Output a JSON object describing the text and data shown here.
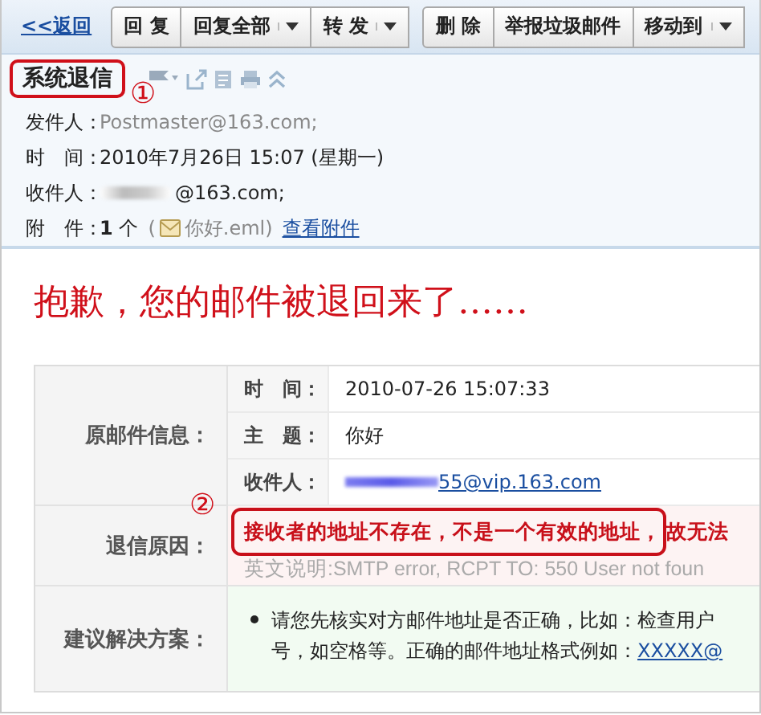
{
  "toolbar": {
    "back_link": "<<返回",
    "groups": [
      [
        {
          "label": "回 复",
          "dropdown": false
        },
        {
          "label": "回复全部",
          "dropdown": true
        },
        {
          "label": "转 发",
          "dropdown": true
        }
      ],
      [
        {
          "label": "删 除",
          "dropdown": false
        },
        {
          "label": "举报垃圾邮件",
          "dropdown": false
        },
        {
          "label": "移动到",
          "dropdown": true
        }
      ]
    ]
  },
  "mail": {
    "subject": "系统退信",
    "subject_marker": "①",
    "fields": [
      {
        "kind": "sender",
        "label": "发件人：",
        "value": "Postmaster@163.com;"
      },
      {
        "kind": "text",
        "label": "时　间：",
        "value": "2010年7月26日 15:07 (星期一)"
      },
      {
        "kind": "redacted",
        "label": "收件人：",
        "value": "@163.com;"
      },
      {
        "kind": "attachment",
        "label": "附　件：",
        "count": "**1** 个",
        "open": "(",
        "file": "你好.eml)",
        "link": "查看附件"
      }
    ]
  },
  "headline": "抱歉，您的邮件被退回来了……",
  "bounce_table": {
    "rows": [
      {
        "kind": "details",
        "label": "原邮件信息：",
        "items": [
          {
            "kind": "text",
            "label": "时　间：",
            "value": "2010-07-26 15:07:33"
          },
          {
            "kind": "text",
            "label": "主　题：",
            "value": "你好"
          },
          {
            "kind": "redacted-link",
            "label": "收件人：",
            "value": "55@vip.163.com"
          }
        ]
      },
      {
        "kind": "reason",
        "label": "退信原因：",
        "marker": "②",
        "reason": "接收者的地址不存在，不是一个有效的地址，",
        "reason_rest": "故无法",
        "note": "英文说明:SMTP error, RCPT TO: 550 User not foun"
      },
      {
        "kind": "suggestion",
        "label": "建议解决方案：",
        "lines": [
          "请您先核实对方邮件地址是否正确，比如：检查用户",
          "号，如空格等。正确的邮件地址格式例如："
        ],
        "link": "XXXXX@"
      }
    ]
  }
}
